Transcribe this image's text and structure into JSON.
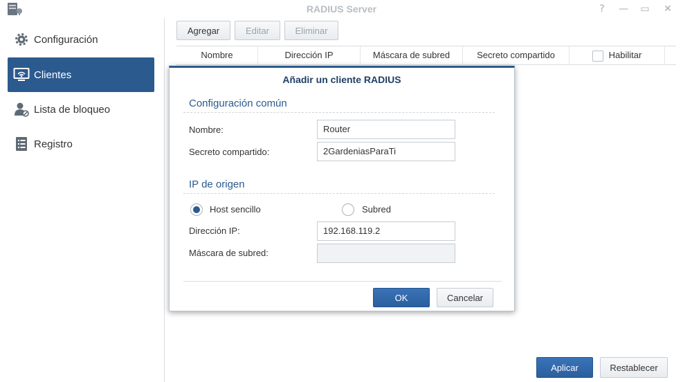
{
  "window": {
    "title": "RADIUS Server",
    "controls": {
      "help": "?",
      "minimize": "—",
      "maximize": "▭",
      "close": "✕"
    }
  },
  "sidebar": {
    "items": [
      {
        "label": "Configuración",
        "icon": "gear-icon"
      },
      {
        "label": "Clientes",
        "icon": "monitor-wifi-icon",
        "active": true
      },
      {
        "label": "Lista de bloqueo",
        "icon": "user-block-icon"
      },
      {
        "label": "Registro",
        "icon": "list-document-icon"
      }
    ]
  },
  "toolbar": {
    "add_label": "Agregar",
    "edit_label": "Editar",
    "delete_label": "Eliminar"
  },
  "table": {
    "columns": [
      "Nombre",
      "Dirección IP",
      "Máscara de subred",
      "Secreto compartido",
      "Habilitar"
    ]
  },
  "dialog": {
    "title": "Añadir un cliente RADIUS",
    "common_section": "Configuración común",
    "name_label": "Nombre:",
    "name_value": "Router",
    "secret_label": "Secreto compartido:",
    "secret_value": "2GardeniasParaTi",
    "source_section": "IP de origen",
    "radio_single_host": "Host sencillo",
    "radio_subnet": "Subred",
    "ip_label": "Dirección IP:",
    "ip_value": "192.168.119.2",
    "mask_label": "Máscara de subred:",
    "mask_value": "",
    "ok_label": "OK",
    "cancel_label": "Cancelar"
  },
  "footer": {
    "apply_label": "Aplicar",
    "reset_label": "Restablecer"
  },
  "colors": {
    "accent": "#2b5a8f",
    "title_text": "#b8bec4",
    "primary_button": "#3a73b8"
  }
}
